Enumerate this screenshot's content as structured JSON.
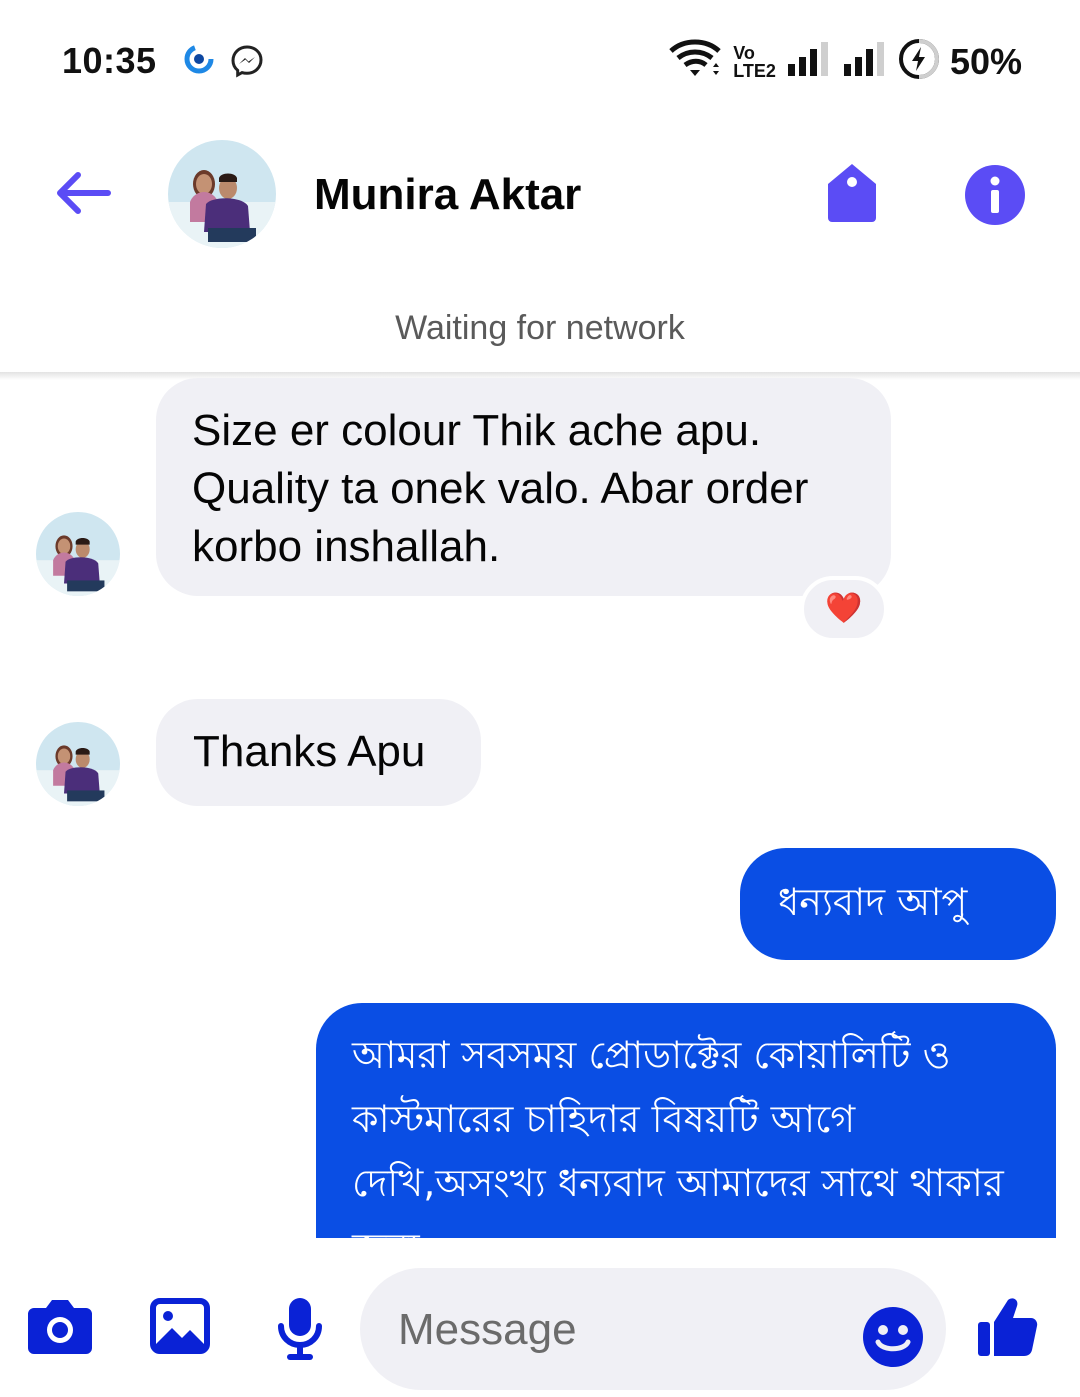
{
  "status_bar": {
    "time": "10:35",
    "battery": "50%",
    "icons": [
      "app-notification-icon",
      "messenger-icon",
      "wifi-icon",
      "volte-icon",
      "signal-icon",
      "signal-icon",
      "battery-saver-icon"
    ],
    "volte_line1": "Vo",
    "volte_line2": "LTE2"
  },
  "header": {
    "contact_name": "Munira Aktar",
    "network_status": "Waiting for network",
    "icons": [
      "back-arrow-icon",
      "tag-icon",
      "info-icon"
    ]
  },
  "messages": [
    {
      "direction": "incoming",
      "text": "Size er colour Thik ache apu. Quality ta onek valo. Abar order korbo inshallah.",
      "reaction": "❤️"
    },
    {
      "direction": "incoming",
      "text": "Thanks Apu"
    },
    {
      "direction": "outgoing",
      "text": "ধন্যবাদ আপু"
    },
    {
      "direction": "outgoing",
      "text": "আমরা সবসময় প্রোডাক্টের কোয়ালিটি ও কাস্টমারের চাহিদার বিষয়টি আগে দেখি,অসংখ্য ধন্যবাদ আমাদের সাথে থাকার জন্য"
    }
  ],
  "composer": {
    "placeholder": "Message",
    "icons": [
      "camera-icon",
      "gallery-icon",
      "microphone-icon",
      "emoji-icon",
      "thumbs-up-icon"
    ]
  },
  "colors": {
    "accent": "#0a4ee4",
    "accent_purple": "#5b4cf5",
    "icon_blue": "#0a22d6",
    "incoming_bubble": "#f0f0f5",
    "heart": "#e0162b"
  }
}
